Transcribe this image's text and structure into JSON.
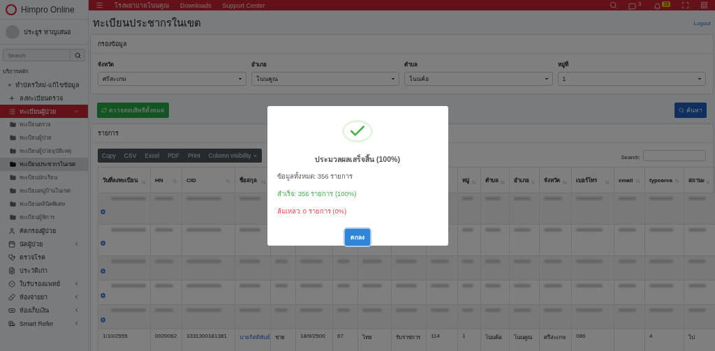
{
  "sidebar": {
    "brand": "Himpro Online",
    "user": "ประยูร หาญเสนอ",
    "search": {
      "placeholder": "Search"
    },
    "section": "บริการหลัก",
    "items": [
      {
        "label": "ทำบัตรใหม่-แก้ไขข้อมูล",
        "selected": false
      },
      {
        "label": "ลงทะเบียนตรวจ",
        "selected": false
      },
      {
        "label": "ทะเบียนผู้ป่วย",
        "selected": true,
        "expanded": true,
        "children": [
          {
            "label": "ทะเบียนตรวจ",
            "selected": false
          },
          {
            "label": "ทะเบียนผู้ป่วย",
            "selected": false
          },
          {
            "label": "ทะเบียนผู้ป่วยอุบัติเหตุ",
            "selected": false
          },
          {
            "label": "ทะเบียนประชากรในเขต",
            "selected": true
          },
          {
            "label": "ทะเบียนนักเรียน",
            "selected": false
          },
          {
            "label": "ทะเบียนหมู่บ้านในเขต",
            "selected": false
          },
          {
            "label": "ทะเบียนคลินิคพิเศษ",
            "selected": false
          },
          {
            "label": "ทะเบียนผู้พิการ",
            "selected": false
          }
        ]
      },
      {
        "label": "คัดกรองผู้ป่วย",
        "selected": false
      },
      {
        "label": "นัดผู้ป่วย",
        "selected": false,
        "expanded": false
      },
      {
        "label": "ตรวจโรค",
        "selected": false
      },
      {
        "label": "ประวัติเก่า",
        "selected": false
      },
      {
        "label": "ใบรับรองแพทย์",
        "selected": false,
        "expanded": false
      },
      {
        "label": "ห้องจ่ายยา",
        "selected": false,
        "expanded": false
      },
      {
        "label": "ห้องเก็บเงิน",
        "selected": false,
        "expanded": false
      },
      {
        "label": "Smart Refer",
        "selected": false,
        "expanded": false
      }
    ]
  },
  "navbar": {
    "links": [
      "โรงพยาบาลโนนคูณ",
      "Downloads",
      "Support Center"
    ],
    "messages_badge": "3",
    "notifications_badge": "15"
  },
  "page": {
    "title": "ทะเบียนประชากรในเขต",
    "logout": "Logout"
  },
  "filter": {
    "title": "กรองข้อมูล",
    "fields": [
      {
        "label": "จังหวัด",
        "value": "ศรีสะเกษ"
      },
      {
        "label": "อำเภอ",
        "value": "โนนคูณ"
      },
      {
        "label": "ตำบล",
        "value": "โนนค้อ"
      },
      {
        "label": "หมู่ที่",
        "value": "1"
      }
    ],
    "check_button": "ตรวจสอบสิทธิทั้งหมด",
    "search_button": "ค้นหา"
  },
  "list": {
    "title": "รายการ",
    "export_buttons": [
      "Copy",
      "CSV",
      "Excel",
      "PDF",
      "Print",
      "Column visibility"
    ],
    "search_label": "Search:",
    "table": {
      "columns": [
        {
          "label": "วันที่ลงทะเบียน"
        },
        {
          "label": "HN"
        },
        {
          "label": "CID"
        },
        {
          "label": "ชื่อสกุล"
        },
        {},
        {},
        {},
        {},
        {},
        {},
        {
          "label": "หมู่"
        },
        {
          "label": "ตำบล"
        },
        {
          "label": "อำเภอ"
        },
        {
          "label": "จังหวัด"
        },
        {
          "label": "เบอร์โทร"
        },
        {
          "label": "email"
        },
        {
          "label": "typearea"
        },
        {
          "label": "สถานะ"
        }
      ],
      "rows": [
        {
          "blurred": true
        },
        {
          "blurred": true
        },
        {
          "blurred": true
        },
        {
          "blurred": true
        },
        {
          "blurred": true
        },
        {
          "blurred": false,
          "cells": [
            "1/10/2555",
            "0020062",
            "3331300181381",
            "นายกิตติพันธ์",
            "ชาย",
            "18/9/2500",
            "67",
            "ไทย",
            "รับราชการ",
            "114",
            "1",
            "โนนค้อ",
            "โนนคูณ",
            "ศรีสะเกษ",
            "086",
            null,
            "4",
            "ไป"
          ]
        }
      ]
    }
  },
  "modal": {
    "title": "ประมวลผลเสร็จสิ้น (100%)",
    "lines": [
      {
        "kind": "total",
        "text": "ข้อมูลทั้งหมด: 356 รายการ"
      },
      {
        "kind": "success",
        "text": "สำเร็จ: 356 รายการ (100%)"
      },
      {
        "kind": "failure",
        "text": "ล้มเหลว: 0 รายการ (0%)"
      }
    ],
    "button": "ตกลง"
  }
}
